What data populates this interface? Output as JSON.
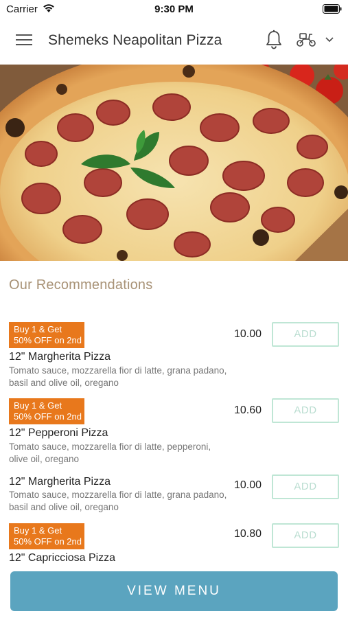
{
  "status_bar": {
    "carrier": "Carrier",
    "time": "9:30 PM"
  },
  "header": {
    "title": "Shemeks Neapolitan Pizza",
    "icons": [
      "menu-icon",
      "bell-icon",
      "scooter-icon",
      "chevron-down-icon"
    ]
  },
  "hero": {
    "icon": "pepperoni-pizza-photo"
  },
  "recommendations": {
    "title": "Our Recommendations",
    "add_label": "ADD",
    "items": [
      {
        "promo_line1": "Buy 1 & Get",
        "promo_line2": "50% OFF on 2nd",
        "name": "12\" Margherita Pizza",
        "description": "Tomato sauce, mozzarella fior di latte, grana padano, basil and olive oil, oregano",
        "price": "10.00"
      },
      {
        "promo_line1": "Buy 1 & Get",
        "promo_line2": "50% OFF on 2nd",
        "name": "12\" Pepperoni Pizza",
        "description": "Tomato sauce, mozzarella fior di latte, pepperoni, olive oil, oregano",
        "price": "10.60"
      },
      {
        "name": "12\" Margherita Pizza",
        "description": "Tomato sauce, mozzarella fior di latte, grana padano, basil and olive oil, oregano",
        "price": "10.00"
      },
      {
        "promo_line1": "Buy 1 & Get",
        "promo_line2": "50% OFF on 2nd",
        "name": "12\" Capricciosa Pizza",
        "price": "10.80"
      }
    ]
  },
  "footer": {
    "view_menu_label": "VIEW MENU"
  },
  "colors": {
    "promo_badge": "#e8781c",
    "section_title": "#a89276",
    "add_border": "#bfe6d5",
    "view_menu_button": "#5ba4bf"
  }
}
